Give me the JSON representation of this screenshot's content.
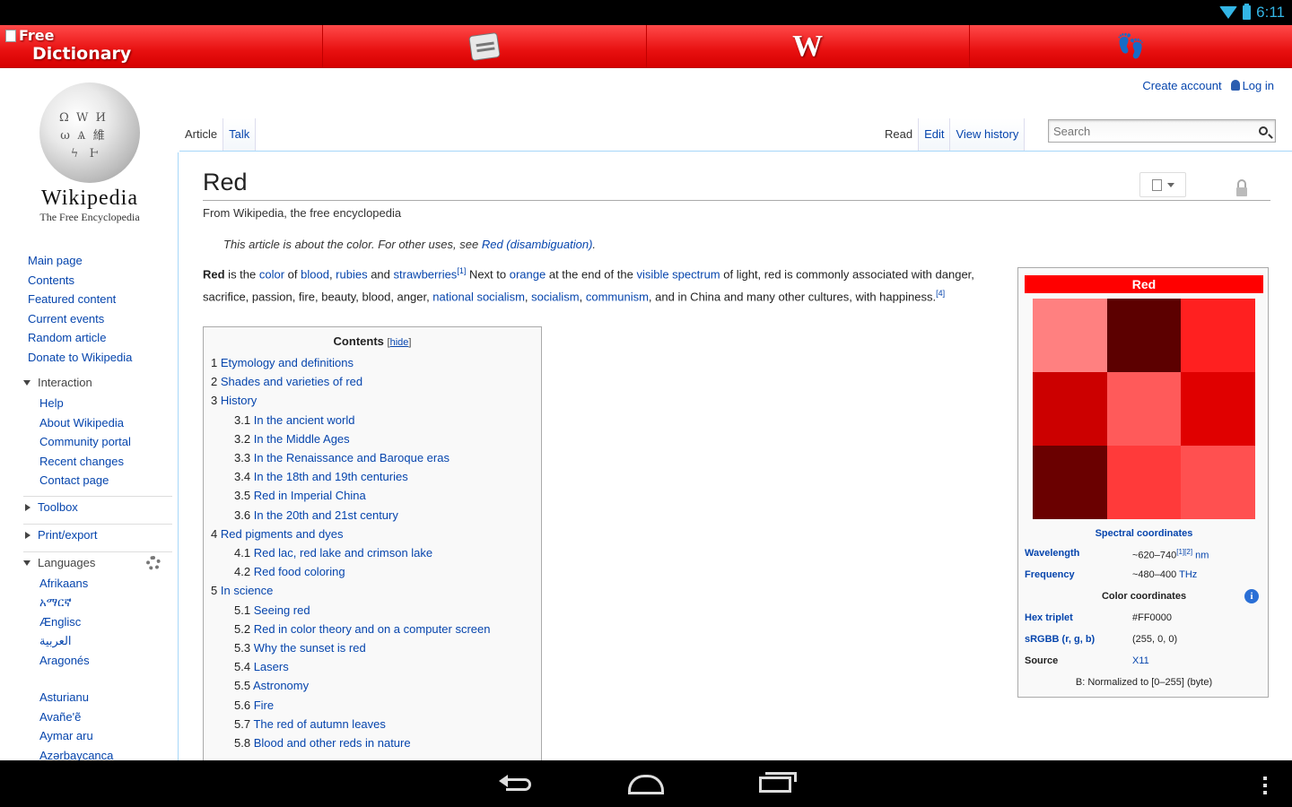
{
  "status_bar": {
    "time": "6:11"
  },
  "app_bar": {
    "logo_line1": "Free",
    "logo_line2": "Dictionary",
    "wiki_glyph": "W"
  },
  "wiki_logo": {
    "wordmark": "Wikipedia",
    "tagline": "The Free Encyclopedia"
  },
  "personal": {
    "create_account": "Create account",
    "login": "Log in"
  },
  "tabs": {
    "article": "Article",
    "talk": "Talk",
    "read": "Read",
    "edit": "Edit",
    "view_history": "View history"
  },
  "search": {
    "placeholder": "Search"
  },
  "sidebar": {
    "main": [
      "Main page",
      "Contents",
      "Featured content",
      "Current events",
      "Random article",
      "Donate to Wikipedia"
    ],
    "interaction": {
      "label": "Interaction",
      "items": [
        "Help",
        "About Wikipedia",
        "Community portal",
        "Recent changes",
        "Contact page"
      ]
    },
    "toolbox": "Toolbox",
    "print_export": "Print/export",
    "languages": {
      "label": "Languages",
      "items": [
        "Afrikaans",
        "አማርኛ",
        "Ænglisc",
        "العربية",
        "Aragonés",
        "Asturianu",
        "Avañe'ẽ",
        "Aymar aru",
        "Azərbaycanca"
      ]
    }
  },
  "article": {
    "title": "Red",
    "tagline": "From Wikipedia, the free encyclopedia",
    "hatnote_pre": "This article is about the color. For other uses, see ",
    "hatnote_link": "Red (disambiguation)",
    "hatnote_post": ".",
    "lead": {
      "bold": "Red",
      "t1": " is the ",
      "l_color": "color",
      "t2": " of ",
      "l_blood": "blood",
      "t3": ", ",
      "l_rubies": "rubies",
      "t4": " and ",
      "l_strawberries": "strawberries",
      "sup1": "[1]",
      "t5": " Next to ",
      "l_orange": "orange",
      "t6": " at the end of the ",
      "l_visible": "visible spectrum",
      "t7": " of light, red is commonly associated with danger, sacrifice, passion, fire, beauty, blood, anger, ",
      "l_natsoc": "national socialism",
      "t8": ", ",
      "l_soc": "socialism",
      "t9": ", ",
      "l_comm": "communism",
      "t10": ", and in China and many other cultures, with happiness.",
      "sup2": "[4]"
    }
  },
  "toc": {
    "title": "Contents",
    "hide_open": "[",
    "hide": "hide",
    "hide_close": "]",
    "entries": [
      {
        "num": "1",
        "text": "Etymology and definitions",
        "level": 1
      },
      {
        "num": "2",
        "text": "Shades and varieties of red",
        "level": 1
      },
      {
        "num": "3",
        "text": "History",
        "level": 1
      },
      {
        "num": "3.1",
        "text": "In the ancient world",
        "level": 2
      },
      {
        "num": "3.2",
        "text": "In the Middle Ages",
        "level": 2
      },
      {
        "num": "3.3",
        "text": "In the Renaissance and Baroque eras",
        "level": 2
      },
      {
        "num": "3.4",
        "text": "In the 18th and 19th centuries",
        "level": 2
      },
      {
        "num": "3.5",
        "text": "Red in Imperial China",
        "level": 2
      },
      {
        "num": "3.6",
        "text": "In the 20th and 21st century",
        "level": 2
      },
      {
        "num": "4",
        "text": "Red pigments and dyes",
        "level": 1
      },
      {
        "num": "4.1",
        "text": "Red lac, red lake and crimson lake",
        "level": 2
      },
      {
        "num": "4.2",
        "text": "Red food coloring",
        "level": 2
      },
      {
        "num": "5",
        "text": "In science",
        "level": 1
      },
      {
        "num": "5.1",
        "text": "Seeing red",
        "level": 2
      },
      {
        "num": "5.2",
        "text": "Red in color theory and on a computer screen",
        "level": 2
      },
      {
        "num": "5.3",
        "text": "Why the sunset is red",
        "level": 2
      },
      {
        "num": "5.4",
        "text": "Lasers",
        "level": 2
      },
      {
        "num": "5.5",
        "text": "Astronomy",
        "level": 2
      },
      {
        "num": "5.6",
        "text": "Fire",
        "level": 2
      },
      {
        "num": "5.7",
        "text": "The red of autumn leaves",
        "level": 2
      },
      {
        "num": "5.8",
        "text": "Blood and other reds in nature",
        "level": 2
      }
    ]
  },
  "infobox": {
    "title": "Red",
    "swatches": [
      "#ff8080",
      "#5c0000",
      "#ff2020",
      "#cc0000",
      "#ff5a5a",
      "#e00000",
      "#6a0000",
      "#ff3a3a",
      "#ff5050"
    ],
    "spectral_header": "Spectral coordinates",
    "wavelength_label": "Wavelength",
    "wavelength_value": "~620–740",
    "wavelength_refs": "[1][2]",
    "wavelength_unit": "nm",
    "frequency_label": "Frequency",
    "frequency_value": "~480–400 ",
    "frequency_unit": "THz",
    "color_header": "Color coordinates",
    "hex_label": "Hex triplet",
    "hex_value": "#FF0000",
    "srgb_label": "sRGBB (r, g, b)",
    "srgb_value": "(255, 0, 0)",
    "source_label": "Source",
    "source_value": "X11",
    "footnote": "B: Normalized to [0–255] (byte)"
  }
}
